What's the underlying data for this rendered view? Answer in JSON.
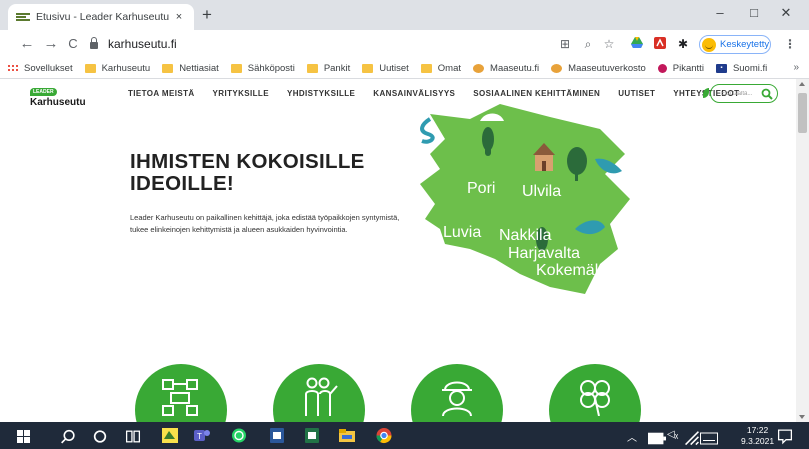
{
  "browser": {
    "tab": {
      "title": "Etusivu - Leader Karhuseutu",
      "close": "×"
    },
    "new_tab": "+",
    "window_controls": {
      "minimize": "–",
      "maximize": "□",
      "close": "✕"
    },
    "nav": {
      "back": "←",
      "forward": "→",
      "reload": "C"
    },
    "url": "karhuseutu.fi",
    "profile_label": "Keskeytetty",
    "bookmarks": [
      {
        "label": "Sovellukset",
        "icon": "apps-grid-icon"
      },
      {
        "label": "Karhuseutu",
        "icon": "folder-icon"
      },
      {
        "label": "Nettiasiat",
        "icon": "folder-icon"
      },
      {
        "label": "Sähköposti",
        "icon": "folder-icon"
      },
      {
        "label": "Pankit",
        "icon": "folder-icon"
      },
      {
        "label": "Uutiset",
        "icon": "folder-icon"
      },
      {
        "label": "Omat",
        "icon": "folder-icon"
      },
      {
        "label": "Maaseutu.fi",
        "icon": "maaseutu-icon"
      },
      {
        "label": "Maaseutuverkosto",
        "icon": "maaseutu-icon"
      },
      {
        "label": "Pikantti",
        "icon": "pikantti-icon"
      },
      {
        "label": "Suomi.fi",
        "icon": "suomi-icon"
      }
    ],
    "bookmarks_more": "»"
  },
  "site": {
    "logo_badge": "LEADER",
    "logo_name": "Karhuseutu",
    "nav": [
      "TIETOA MEISTÄ",
      "YRITYKSILLE",
      "YHDISTYKSILLE",
      "KANSAINVÄLISYYS",
      "SOSIAALINEN KEHITTÄMINEN",
      "UUTISET",
      "YHTEYSTIEDOT"
    ],
    "search_placeholder": "Etsi täältä...",
    "hero_title_line1": "IHMISTEN KOKOISILLE",
    "hero_title_line2": "IDEOILLE!",
    "hero_text": "Leader Karhuseutu on paikallinen kehittäjä, joka edistää työpaikkojen syntymistä, tukee elinkeinojen kehittymistä ja alueen asukkaiden hyvinvointia.",
    "map_towns": [
      "Pori",
      "Ulvila",
      "Luvia",
      "Nakkila",
      "Harjavalta",
      "Kokemäki"
    ],
    "colors": {
      "brand_green": "#39a935",
      "map_green": "#6dbf4b",
      "water_blue": "#2f9bb0"
    }
  },
  "taskbar": {
    "time": "17:22",
    "date": "9.3.2021"
  }
}
